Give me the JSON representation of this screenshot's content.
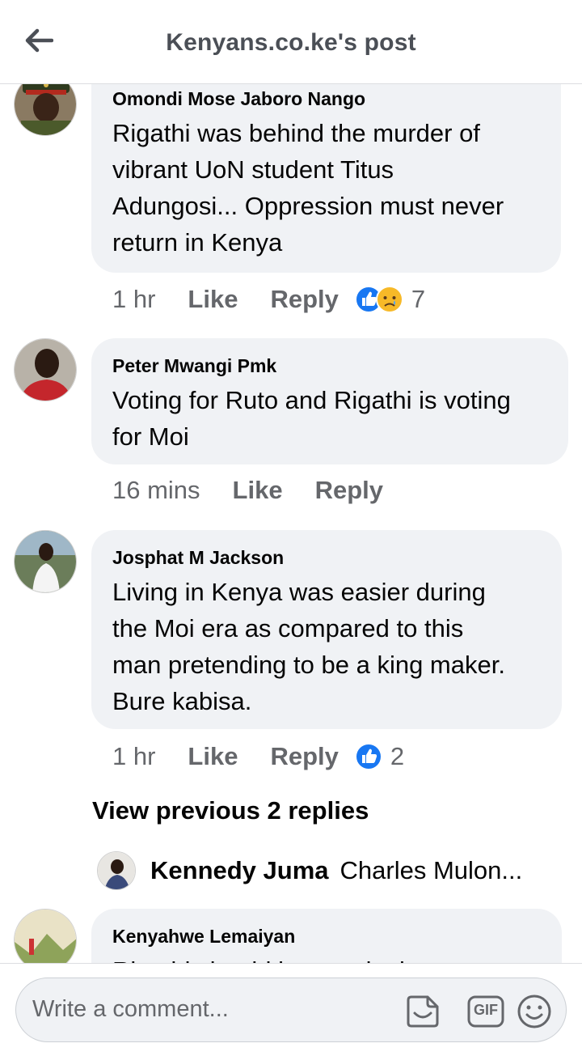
{
  "header": {
    "title": "Kenyans.co.ke's post"
  },
  "comments": [
    {
      "author": "Omondi Mose Jaboro Nango",
      "lines": [
        "Rigathi was behind  the murder of",
        "vibrant UoN student Titus",
        "Adungosi... Oppression must never",
        "return in Kenya"
      ],
      "time": "1 hr",
      "like": "Like",
      "reply": "Reply",
      "reactions": [
        "like",
        "sad"
      ],
      "reaction_count": "7"
    },
    {
      "author": "Peter Mwangi Pmk",
      "lines": [
        "Voting for Ruto and Rigathi is voting",
        "for Moi"
      ],
      "time": "16 mins",
      "like": "Like",
      "reply": "Reply"
    },
    {
      "author": "Josphat M Jackson",
      "lines": [
        "Living in Kenya was easier during",
        "the Moi era as compared to this",
        "man pretending to be a king maker.",
        "Bure kabisa."
      ],
      "time": "1 hr",
      "like": "Like",
      "reply": "Reply",
      "reactions": [
        "like"
      ],
      "reaction_count": "2"
    },
    {
      "author": "Kenyahwe Lemaiyan",
      "lines": [
        "Rigathi should just apologize so we"
      ]
    }
  ],
  "view_previous": "View previous 2 replies",
  "reply_preview": {
    "name": "Kennedy Juma",
    "snippet": "Charles Mulon..."
  },
  "composer": {
    "placeholder": "Write a comment...",
    "gif_label": "GIF"
  },
  "colors": {
    "like_blue": "#1877f2",
    "sad_yellow": "#f7b928",
    "bubble": "#f0f2f5",
    "meta": "#65676b"
  }
}
